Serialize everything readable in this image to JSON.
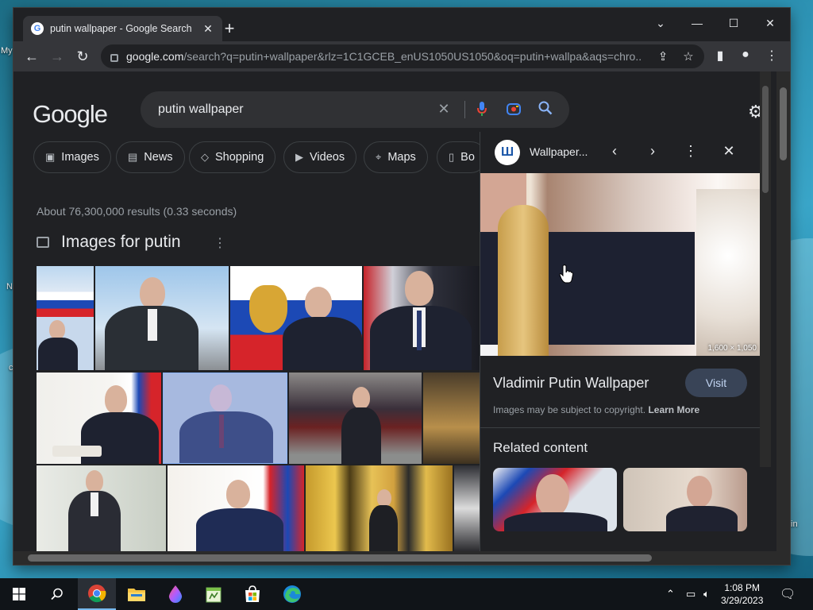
{
  "desktop": {
    "labels": [
      "My",
      "N",
      "c",
      "in"
    ]
  },
  "browser": {
    "tab_title": "putin wallpaper - Google Search",
    "tab_favicon": "G",
    "url_host": "google.com",
    "url_path": "/search?q=putin+wallpaper&rlz=1C1GCEB_enUS1050US1050&oq=putin+wallpa&aqs=chro...",
    "window_controls": {
      "dropdown": "⌄",
      "minimize": "—",
      "maximize": "☐",
      "close": "✕"
    }
  },
  "search": {
    "logo_text": "Google",
    "query": "putin wallpaper",
    "chips": [
      {
        "label": "Images",
        "icon": "image-icon"
      },
      {
        "label": "News",
        "icon": "news-icon"
      },
      {
        "label": "Shopping",
        "icon": "tag-icon"
      },
      {
        "label": "Videos",
        "icon": "video-icon"
      },
      {
        "label": "Maps",
        "icon": "map-pin-icon"
      },
      {
        "label": "Bo",
        "icon": "book-icon"
      }
    ],
    "results_count": "About 76,300,000 results (0.33 seconds)",
    "images_section_title": "Images for putin"
  },
  "panel": {
    "site_name": "Wallpaper...",
    "site_logo": "Ш",
    "dimensions": "1,600 × 1,050",
    "title": "Vladimir Putin Wallpaper",
    "visit_label": "Visit",
    "copyright_text": "Images may be subject to copyright.",
    "learn_more": "Learn More",
    "related_title": "Related content"
  },
  "taskbar": {
    "time": "1:08 PM",
    "date": "3/29/2023"
  },
  "colors": {
    "page_bg": "#202124",
    "chrome_toolbar": "#35363a",
    "text_primary": "#e8eaed",
    "text_secondary": "#9aa0a6",
    "visit_button": "#394457"
  }
}
